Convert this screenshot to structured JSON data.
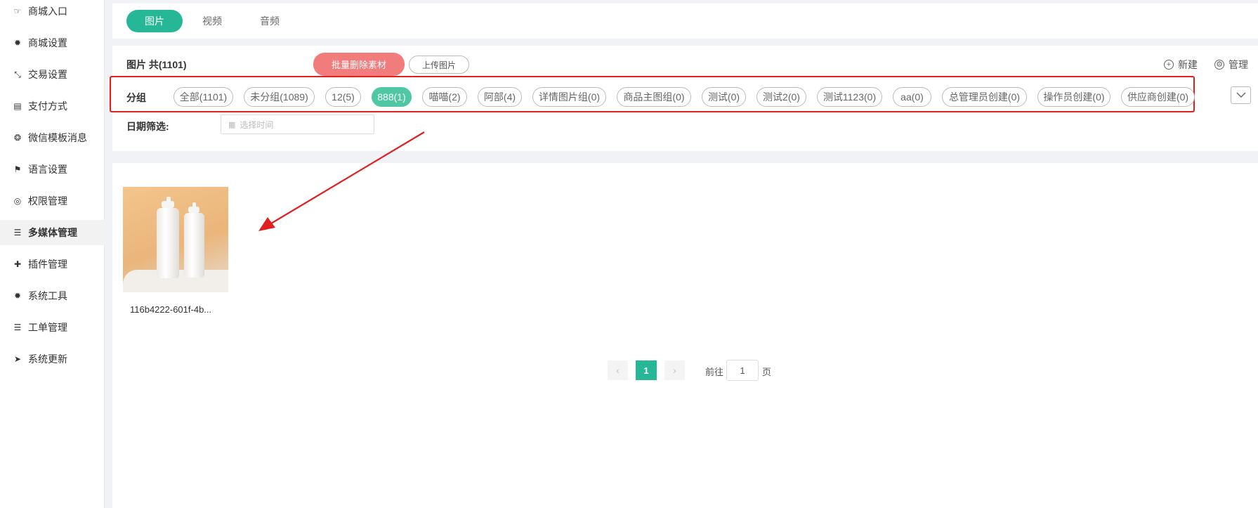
{
  "sidebar": {
    "items": [
      {
        "label": "商城入口",
        "icon": "hand-pointer-icon",
        "glyph": "☞"
      },
      {
        "label": "商城设置",
        "icon": "gear-icon",
        "glyph": "✹"
      },
      {
        "label": "交易设置",
        "icon": "compress-arrows-icon",
        "glyph": "⤡"
      },
      {
        "label": "支付方式",
        "icon": "credit-card-icon",
        "glyph": "▤"
      },
      {
        "label": "微信模板消息",
        "icon": "wechat-icon",
        "glyph": "❂"
      },
      {
        "label": "语言设置",
        "icon": "language-icon",
        "glyph": "⚑"
      },
      {
        "label": "权限管理",
        "icon": "eye-mask-icon",
        "glyph": "◎"
      },
      {
        "label": "多媒体管理",
        "icon": "list-icon",
        "glyph": "☰"
      },
      {
        "label": "插件管理",
        "icon": "puzzle-icon",
        "glyph": "✚"
      },
      {
        "label": "系统工具",
        "icon": "gear-icon",
        "glyph": "✹"
      },
      {
        "label": "工单管理",
        "icon": "list-icon",
        "glyph": "☰"
      },
      {
        "label": "系统更新",
        "icon": "paper-plane-icon",
        "glyph": "➤"
      }
    ],
    "active_index": 7
  },
  "media_tabs": [
    "图片",
    "视频",
    "音频"
  ],
  "toolbar": {
    "count_label": "图片 共(1101)",
    "batch_delete": "批量删除素材",
    "upload": "上传图片",
    "new_label": "新建",
    "manage_label": "管理"
  },
  "groups": {
    "title": "分组",
    "chips": [
      "全部(1101)",
      "未分组(1089)",
      "12(5)",
      "888(1)",
      "喵喵(2)",
      "阿部(4)",
      "详情图片组(0)",
      "商品主图组(0)",
      "测试(0)",
      "测试2(0)",
      "测试1123(0)",
      "aa(0)",
      "总管理员创建(0)",
      "操作员创建(0)",
      "供应商创建(0)"
    ],
    "active": "888(1)"
  },
  "date_filter": {
    "title": "日期筛选:",
    "placeholder": "选择时间"
  },
  "images": [
    {
      "name": "116b4222-601f-4b..."
    }
  ],
  "pagination": {
    "current_page": "1",
    "goto_prefix": "前往",
    "goto_value": "1",
    "goto_suffix": "页"
  },
  "colors": {
    "accent": "#26b896",
    "danger": "#f27c7c",
    "highlight_box": "#e02020"
  }
}
